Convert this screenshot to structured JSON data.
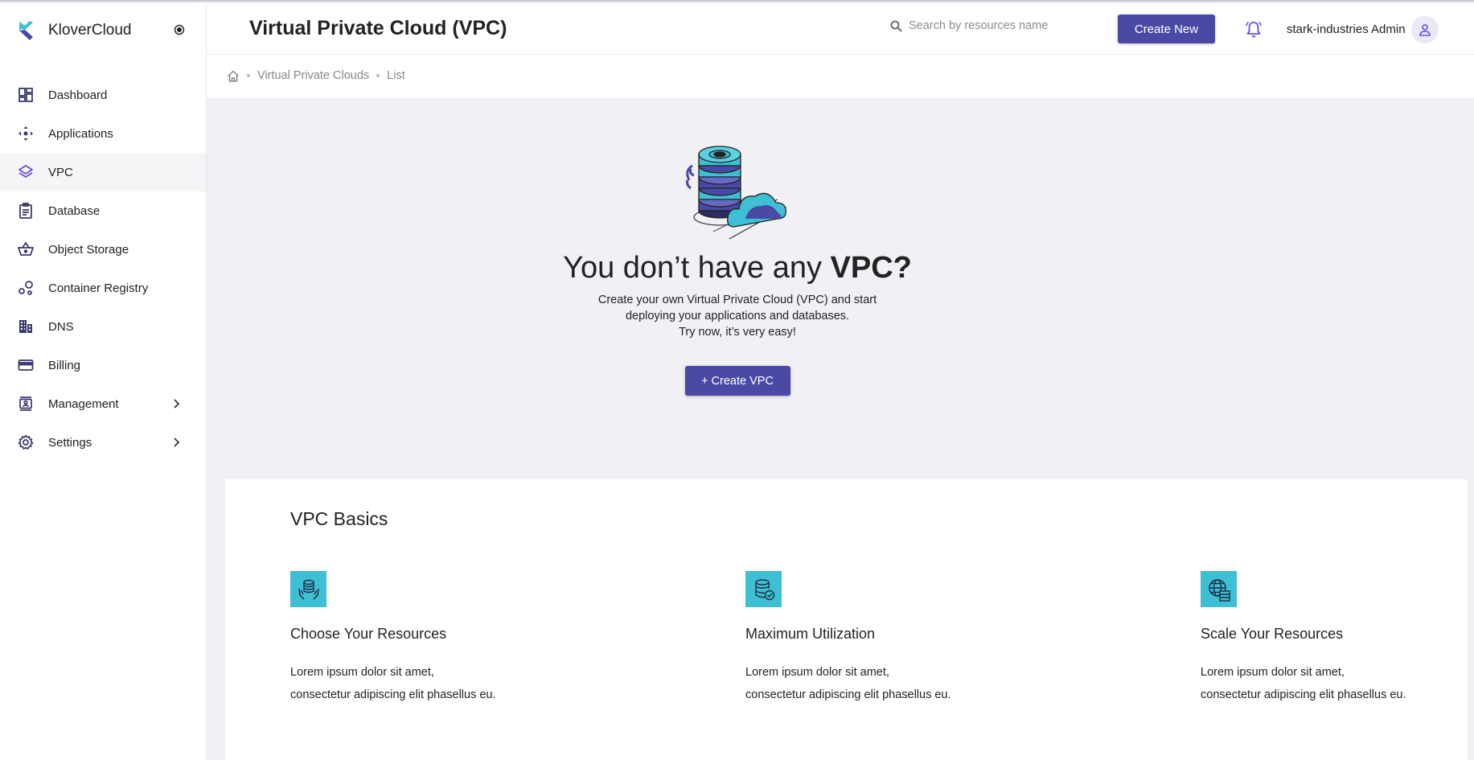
{
  "app": {
    "brand": "KloverCloud"
  },
  "sidebar": {
    "items": [
      {
        "label": "Dashboard",
        "icon": "dashboard-icon"
      },
      {
        "label": "Applications",
        "icon": "applications-icon"
      },
      {
        "label": "VPC",
        "icon": "layers-icon",
        "active": true
      },
      {
        "label": "Database",
        "icon": "database-icon"
      },
      {
        "label": "Object Storage",
        "icon": "basket-icon"
      },
      {
        "label": "Container Registry",
        "icon": "registry-icon"
      },
      {
        "label": "DNS",
        "icon": "dns-icon"
      },
      {
        "label": "Billing",
        "icon": "billing-icon"
      },
      {
        "label": "Management",
        "icon": "management-icon",
        "expandable": true
      },
      {
        "label": "Settings",
        "icon": "gear-icon",
        "expandable": true
      }
    ]
  },
  "header": {
    "title": "Virtual Private Cloud (VPC)",
    "search_placeholder": "Search by resources name",
    "create_new_label": "Create New",
    "user_name": "stark-industries Admin"
  },
  "breadcrumb": {
    "items": [
      "Virtual Private Clouds",
      "List"
    ]
  },
  "empty_state": {
    "title_prefix": "You don’t have any ",
    "title_bold": "VPC?",
    "desc_line1": "Create your own Virtual Private Cloud (VPC) and start",
    "desc_line2": "deploying your applications and databases.",
    "desc_line3": "Try now, it’s very easy!",
    "button_label": "+ Create VPC"
  },
  "basics": {
    "title": "VPC Basics",
    "features": [
      {
        "title": "Choose Your Resources",
        "line1": "Lorem ipsum dolor sit amet,",
        "line2": "consectetur adipiscing elit phasellus eu.",
        "icon": "hands-database-icon"
      },
      {
        "title": "Maximum Utilization",
        "line1": "Lorem ipsum dolor sit amet,",
        "line2": "consectetur adipiscing elit phasellus eu.",
        "icon": "database-check-icon"
      },
      {
        "title": "Scale Your Resources",
        "line1": "Lorem ipsum dolor sit amet,",
        "line2": "consectetur adipiscing elit phasellus eu.",
        "icon": "globe-server-icon"
      }
    ]
  },
  "colors": {
    "accent": "#4a4aa6",
    "teal": "#3ebfd3",
    "nav_icon": "#3c3a6e",
    "active_icon": "#6c4bdc"
  }
}
